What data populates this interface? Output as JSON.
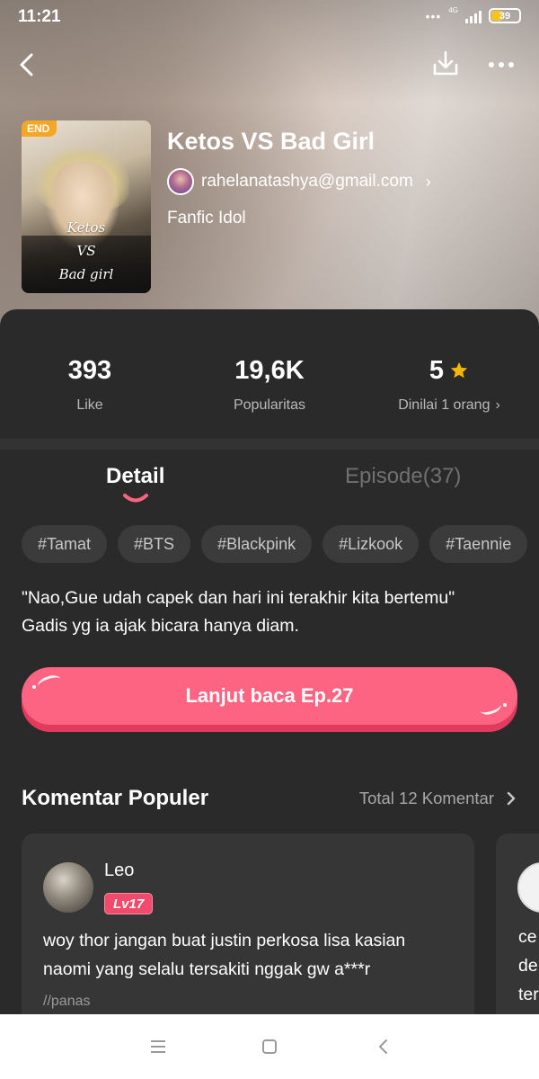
{
  "status_bar": {
    "time": "11:21",
    "network": "4G",
    "battery": "39"
  },
  "book": {
    "title": "Ketos VS Bad Girl",
    "author": "rahelanatashya@gmail.com",
    "category": "Fanfic Idol",
    "badge": "END",
    "cover_title_line1": "Ketos",
    "cover_title_line2": "VS",
    "cover_title_line3": "Bad girl"
  },
  "stats": [
    {
      "value": "393",
      "label": "Like"
    },
    {
      "value": "19,6K",
      "label": "Popularitas"
    },
    {
      "value": "5",
      "label": "Dinilai 1 orang"
    }
  ],
  "tabs": {
    "detail": "Detail",
    "episode": "Episode(37)"
  },
  "tags": [
    "#Tamat",
    "#BTS",
    "#Blackpink",
    "#Lizkook",
    "#Taennie"
  ],
  "synopsis": {
    "line1": "\"Nao,Gue udah capek dan hari ini terakhir kita bertemu\"",
    "line2": "Gadis yg ia ajak bicara hanya diam."
  },
  "cta": {
    "label": "Lanjut baca Ep.27"
  },
  "comments_section": {
    "title": "Komentar Populer",
    "total": "Total 12 Komentar"
  },
  "comments": [
    {
      "name": "Leo",
      "level": "Lv17",
      "text_line1": "woy thor jangan buat justin perkosa lisa kasian",
      "text_line2": "naomi yang selalu tersakiti nggak gw a***r",
      "tag": "//panas"
    }
  ],
  "comment_peek": {
    "line1": "ce",
    "line2": "de",
    "line3": "ter"
  },
  "colors": {
    "accent": "#fd6481",
    "badge": "#f5a623",
    "star": "#f7b500",
    "level_badge": "#f04a6c",
    "background": "#2a2a2a"
  },
  "icons": [
    "back-icon",
    "download-icon",
    "more-icon",
    "star-icon",
    "chevron-right-icon",
    "menu-icon",
    "home-icon",
    "nav-back-icon"
  ]
}
